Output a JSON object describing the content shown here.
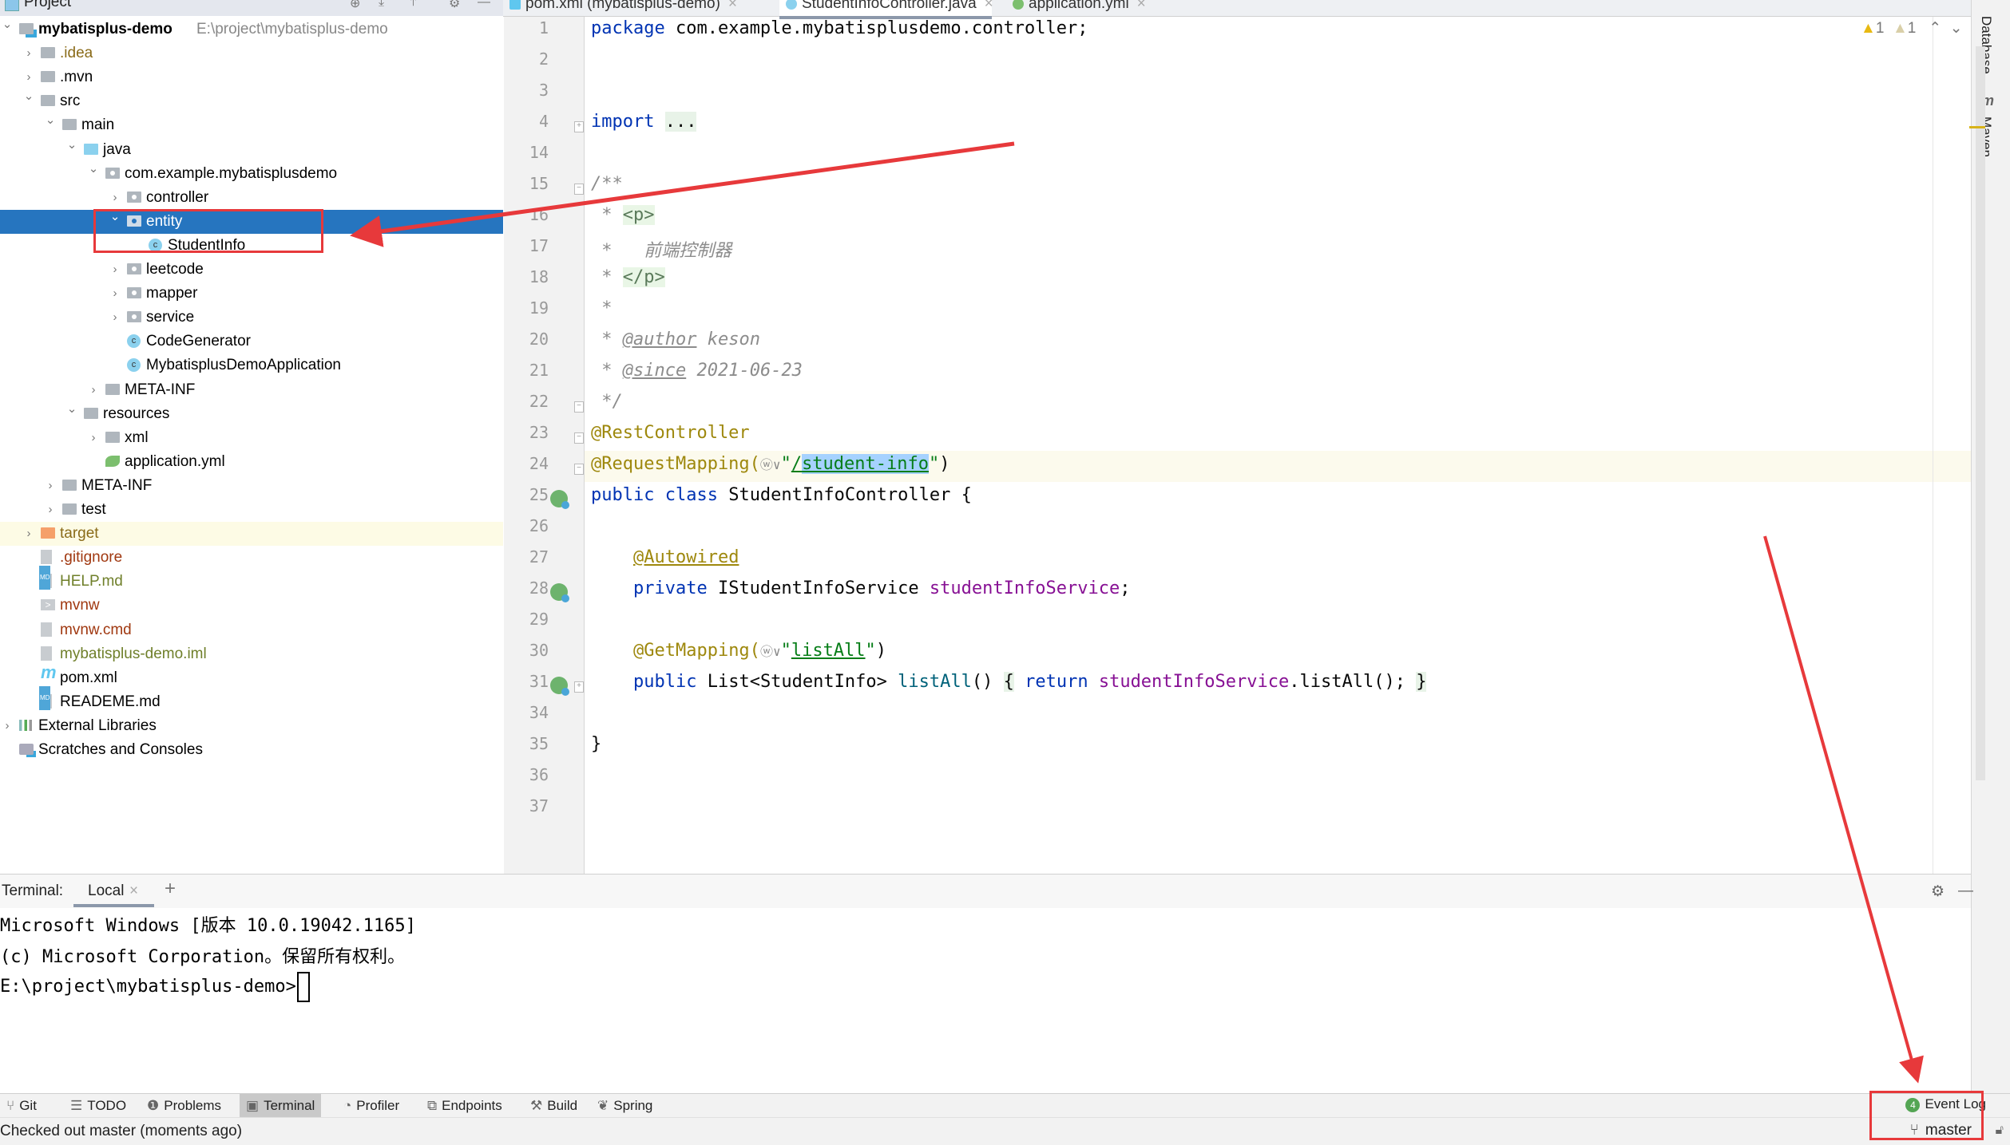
{
  "project_panel": {
    "title": "Project",
    "tree": [
      {
        "label": "mybatisplus-demo",
        "path": "E:\\project\\mybatisplus-demo",
        "icon": "module-folder-icon",
        "expanded": true
      },
      {
        "label": ".idea",
        "icon": "folder-icon"
      },
      {
        "label": ".mvn",
        "icon": "folder-icon"
      },
      {
        "label": "src",
        "icon": "folder-icon",
        "expanded": true
      },
      {
        "label": "main",
        "icon": "folder-icon",
        "expanded": true
      },
      {
        "label": "java",
        "icon": "source-folder-icon",
        "expanded": true
      },
      {
        "label": "com.example.mybatisplusdemo",
        "icon": "package-icon",
        "expanded": true
      },
      {
        "label": "controller",
        "icon": "package-icon"
      },
      {
        "label": "entity",
        "icon": "package-icon",
        "expanded": true,
        "selected": true
      },
      {
        "label": "StudentInfo",
        "icon": "class-icon"
      },
      {
        "label": "leetcode",
        "icon": "package-icon"
      },
      {
        "label": "mapper",
        "icon": "package-icon"
      },
      {
        "label": "service",
        "icon": "package-icon"
      },
      {
        "label": "CodeGenerator",
        "icon": "runnable-class-icon"
      },
      {
        "label": "MybatisplusDemoApplication",
        "icon": "spring-boot-class-icon"
      },
      {
        "label": "META-INF",
        "icon": "folder-icon"
      },
      {
        "label": "resources",
        "icon": "resources-folder-icon",
        "expanded": true
      },
      {
        "label": "xml",
        "icon": "folder-icon"
      },
      {
        "label": "application.yml",
        "icon": "spring-config-icon"
      },
      {
        "label": "META-INF",
        "icon": "folder-icon"
      },
      {
        "label": "test",
        "icon": "folder-icon"
      },
      {
        "label": "target",
        "icon": "excluded-folder-icon"
      },
      {
        "label": ".gitignore",
        "icon": "ignore-file-icon"
      },
      {
        "label": "HELP.md",
        "icon": "markdown-file-icon"
      },
      {
        "label": "mvnw",
        "icon": "shell-script-icon"
      },
      {
        "label": "mvnw.cmd",
        "icon": "text-file-icon"
      },
      {
        "label": "mybatisplus-demo.iml",
        "icon": "iml-file-icon"
      },
      {
        "label": "pom.xml",
        "icon": "maven-icon"
      },
      {
        "label": "READEME.md",
        "icon": "markdown-file-icon"
      },
      {
        "label": "External Libraries",
        "icon": "libraries-icon"
      },
      {
        "label": "Scratches and Consoles",
        "icon": "scratches-icon"
      }
    ]
  },
  "editor": {
    "tabs": [
      {
        "label": "pom.xml (mybatisplus-demo)",
        "icon": "maven-icon"
      },
      {
        "label": "StudentInfoController.java",
        "icon": "class-icon",
        "active": true
      },
      {
        "label": "application.yml",
        "icon": "spring-config-icon"
      }
    ],
    "inspection": {
      "warnings": "1",
      "weak_warnings": "1"
    },
    "line_numbers": [
      "1",
      "2",
      "3",
      "4",
      "14",
      "15",
      "16",
      "17",
      "18",
      "19",
      "20",
      "21",
      "22",
      "23",
      "24",
      "25",
      "26",
      "27",
      "28",
      "29",
      "30",
      "31",
      "34",
      "35",
      "36",
      "37"
    ],
    "code": {
      "l1_kw": "package",
      "l1_rest": " com.example.mybatisplusdemo.controller;",
      "l4_kw": "import",
      "l4_fold": "...",
      "l15": "/**",
      "l16_star": " * ",
      "l16_tag": "<p>",
      "l17": " *   前端控制器",
      "l18_star": " * ",
      "l18_tag": "</p>",
      "l19": " *",
      "l20_star": " * ",
      "l20_tag": "@author",
      "l20_rest": " keson",
      "l21_star": " * ",
      "l21_tag": "@since",
      "l21_rest": " 2021-06-23",
      "l22": " */",
      "l23": "@RestController",
      "l24_ann": "@RequestMapping(",
      "l24_globe": "ⓦ∨",
      "l24_q1": "\"",
      "l24_slash": "/",
      "l24_path": "student-info",
      "l24_q2": "\"",
      "l24_close": ")",
      "l25_kw": "public class",
      "l25_rest": " StudentInfoController {",
      "l27": "@Autowired",
      "l28_kw": "private",
      "l28_type": " IStudentInfoService ",
      "l28_field": "studentInfoService",
      "l28_end": ";",
      "l30_ann": "@GetMapping(",
      "l30_globe": "ⓦ∨",
      "l30_q1": "\"",
      "l30_path": "listAll",
      "l30_q2": "\"",
      "l30_close": ")",
      "l31_kw": "public",
      "l31_type": " List<StudentInfo> ",
      "l31_method": "listAll",
      "l31_parens": "() ",
      "l31_open": "{",
      "l31_return": " return ",
      "l31_field": "studentInfoService",
      "l31_call": ".listAll(); ",
      "l31_closebrace": "}",
      "l35": "}"
    }
  },
  "right_tool_windows": [
    "Database",
    "Maven"
  ],
  "terminal": {
    "label": "Terminal:",
    "tab": "Local",
    "add": "+",
    "lines": [
      "Microsoft Windows [版本 10.0.19042.1165]",
      "(c) Microsoft Corporation。保留所有权利。",
      "E:\\project\\mybatisplus-demo>"
    ]
  },
  "tool_windows": [
    {
      "label": "Git",
      "icon": "git-icon"
    },
    {
      "label": "TODO",
      "icon": "todo-icon"
    },
    {
      "label": "Problems",
      "icon": "problems-icon"
    },
    {
      "label": "Terminal",
      "icon": "terminal-icon",
      "active": true
    },
    {
      "label": "Profiler",
      "icon": "profiler-icon"
    },
    {
      "label": "Endpoints",
      "icon": "endpoints-icon"
    },
    {
      "label": "Build",
      "icon": "build-icon"
    },
    {
      "label": "Spring",
      "icon": "spring-icon"
    }
  ],
  "status": {
    "message": "Checked out master (moments ago)",
    "event_log": "Event Log",
    "event_count": "4",
    "branch": "master"
  },
  "annotation_color": "#e7393b"
}
